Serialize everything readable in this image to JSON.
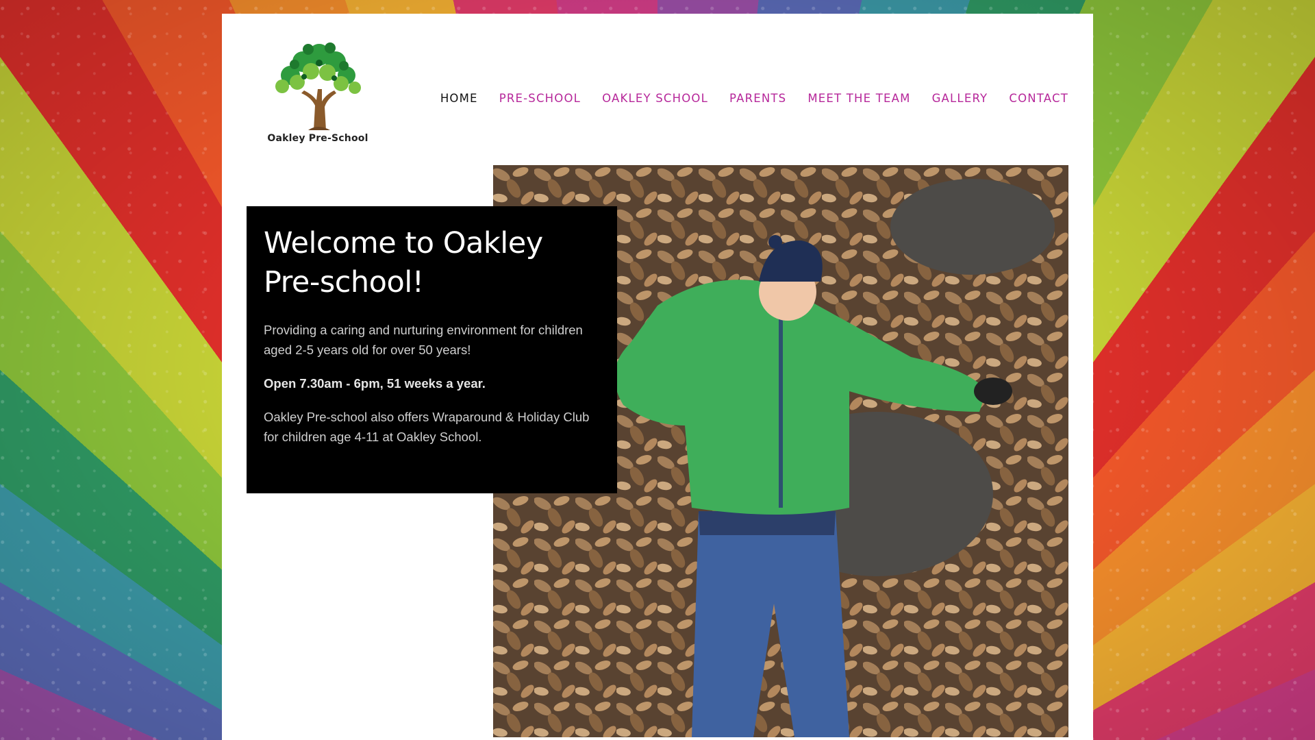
{
  "site": {
    "logo_text": "Oakley Pre-School",
    "logo_icon": "tree-handprints-icon"
  },
  "nav": {
    "items": [
      {
        "label": "HOME",
        "active": true
      },
      {
        "label": "PRE-SCHOOL",
        "active": false
      },
      {
        "label": "OAKLEY SCHOOL",
        "active": false
      },
      {
        "label": "PARENTS",
        "active": false
      },
      {
        "label": "MEET THE TEAM",
        "active": false
      },
      {
        "label": "GALLERY",
        "active": false
      },
      {
        "label": "CONTACT",
        "active": false
      }
    ]
  },
  "hero": {
    "title": "Welcome to Oakley Pre-school!",
    "intro": "Providing a caring and nurturing environment for children aged 2-5 years old for over 50 years!",
    "hours": "Open 7.30am - 6pm, 51 weeks a year.",
    "extra": "Oakley Pre-school also offers Wraparound & Holiday Club for children age 4-11 at Oakley School."
  },
  "colors": {
    "nav_link": "#b6279a",
    "nav_active": "#111111",
    "box_bg": "#000000"
  }
}
